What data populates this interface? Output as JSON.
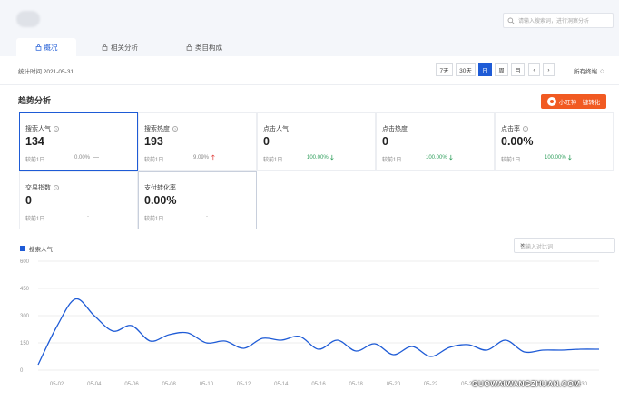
{
  "header": {
    "search_placeholder": "请输入搜索词，进行洞察分析"
  },
  "tabs": [
    {
      "label": "概况",
      "active": true
    },
    {
      "label": "相关分析",
      "active": false
    },
    {
      "label": "类目构成",
      "active": false
    }
  ],
  "datebar": {
    "stat_date": "统计时间 2021-05-31",
    "ranges": [
      {
        "label": "7天",
        "active": false
      },
      {
        "label": "30天",
        "active": false
      },
      {
        "label": "日",
        "active": true
      },
      {
        "label": "周",
        "active": false
      },
      {
        "label": "月",
        "active": false
      }
    ],
    "prev_label": "‹",
    "next_label": "›",
    "terminal_label": "所有终端"
  },
  "section": {
    "title": "趋势分析",
    "cta_label": "小旺神一键转化"
  },
  "metrics": [
    {
      "name": "搜索人气",
      "value": "134",
      "compare": "较前1日",
      "change": "0.00%",
      "trend": "flat"
    },
    {
      "name": "搜索热度",
      "value": "193",
      "compare": "较前1日",
      "change": "9.09%",
      "trend": "up"
    },
    {
      "name": "点击人气",
      "value": "0",
      "compare": "较前1日",
      "change": "100.00%",
      "trend": "down"
    },
    {
      "name": "点击热度",
      "value": "0",
      "compare": "较前1日",
      "change": "100.00%",
      "trend": "down"
    },
    {
      "name": "点击率",
      "value": "0.00%",
      "compare": "较前1日",
      "change": "100.00%",
      "trend": "down"
    },
    {
      "name": "交易指数",
      "value": "0",
      "compare": "较前1日",
      "change": "-",
      "trend": "none"
    },
    {
      "name": "支付转化率",
      "value": "0.00%",
      "compare": "较前1日",
      "change": "-",
      "trend": "none"
    }
  ],
  "chart_controls": {
    "compare_placeholder": "请输入对比词",
    "close_label": "×"
  },
  "colors": {
    "accent": "#1e5bd6",
    "cta": "#f15a22",
    "up": "#e0433f",
    "down": "#2e9e5b"
  },
  "chart_data": {
    "type": "line",
    "x": [
      "05-01",
      "05-02",
      "05-03",
      "05-04",
      "05-05",
      "05-06",
      "05-07",
      "05-08",
      "05-09",
      "05-10",
      "05-11",
      "05-12",
      "05-13",
      "05-14",
      "05-15",
      "05-16",
      "05-17",
      "05-18",
      "05-19",
      "05-20",
      "05-21",
      "05-22",
      "05-23",
      "05-24",
      "05-25",
      "05-26",
      "05-27",
      "05-28",
      "05-29",
      "05-30",
      "05-31"
    ],
    "x_ticks": [
      "05-02",
      "05-04",
      "05-06",
      "05-08",
      "05-10",
      "05-12",
      "05-14",
      "05-16",
      "05-18",
      "05-20",
      "05-22",
      "05-24",
      "05-26",
      "05-28",
      "05-30"
    ],
    "series": [
      {
        "name": "搜索人气",
        "values": [
          30,
          240,
          392,
          300,
          215,
          245,
          160,
          195,
          205,
          150,
          160,
          120,
          175,
          165,
          185,
          115,
          165,
          105,
          145,
          85,
          130,
          75,
          125,
          140,
          110,
          165,
          100,
          110,
          110,
          115,
          115
        ]
      }
    ],
    "ylim": [
      0,
      600
    ],
    "y_ticks": [
      0,
      150,
      300,
      450,
      600
    ]
  }
}
